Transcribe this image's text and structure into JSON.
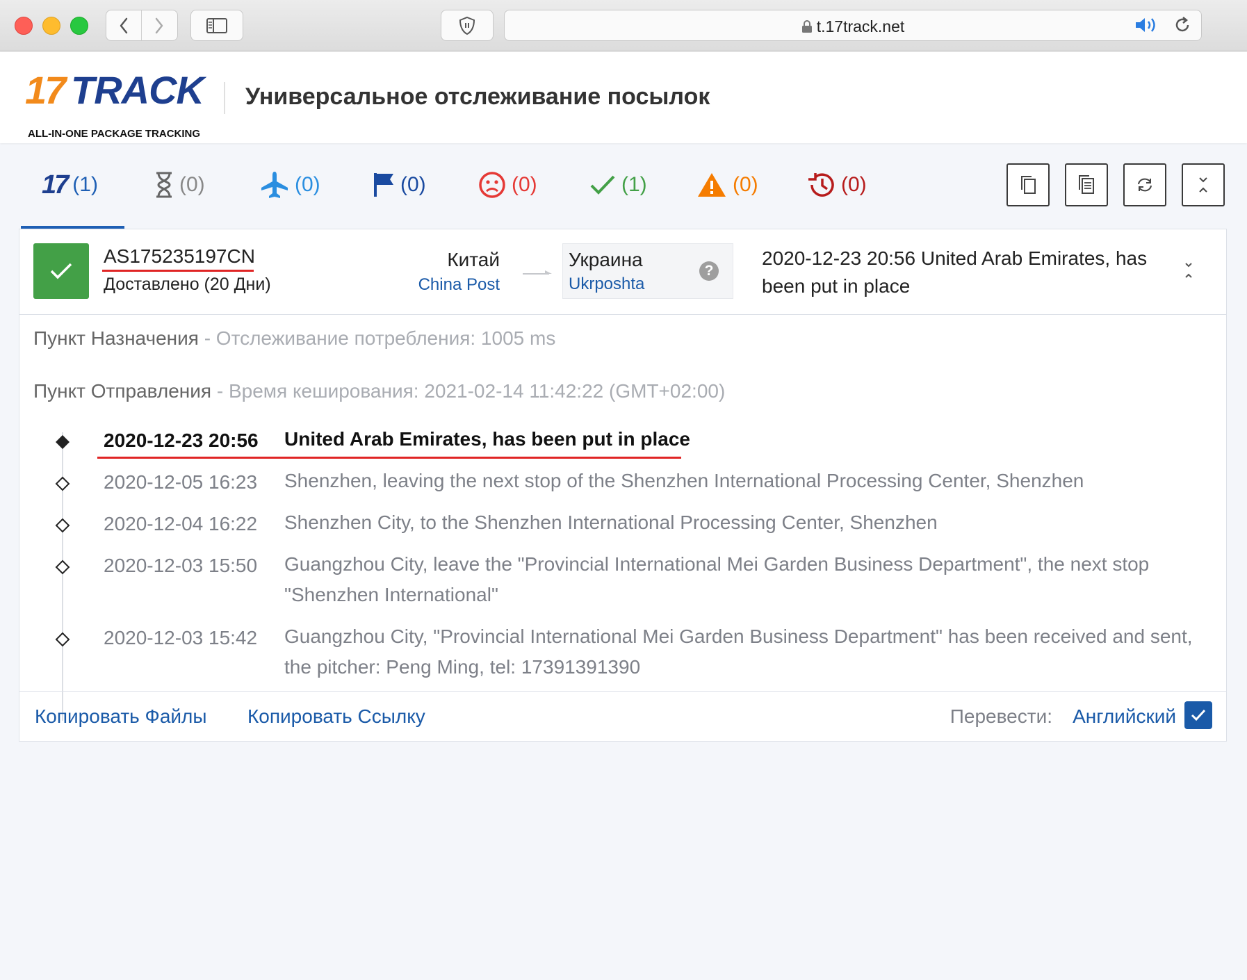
{
  "browser": {
    "url": "t.17track.net"
  },
  "header": {
    "logo_number": "17",
    "logo_word": "TRACK",
    "logo_tagline": "ALL-IN-ONE PACKAGE TRACKING",
    "title": "Универсальное отслеживание посылок"
  },
  "tabs": [
    {
      "icon": "17track-logo-icon",
      "count": "(1)",
      "color": "#1e5fb4"
    },
    {
      "icon": "hourglass-icon",
      "count": "(0)",
      "color": "#888888"
    },
    {
      "icon": "airplane-icon",
      "count": "(0)",
      "color": "#2a8ee0"
    },
    {
      "icon": "flag-icon",
      "count": "(0)",
      "color": "#1a4aa0"
    },
    {
      "icon": "sad-face-icon",
      "count": "(0)",
      "color": "#e53935"
    },
    {
      "icon": "checkmark-icon",
      "count": "(1)",
      "color": "#43a047"
    },
    {
      "icon": "warning-icon",
      "count": "(0)",
      "color": "#f57c00"
    },
    {
      "icon": "history-icon",
      "count": "(0)",
      "color": "#b71c1c"
    }
  ],
  "toolbar": {
    "buttons": [
      "copy-icon",
      "copy-list-icon",
      "refresh-icon",
      "collapse-all-icon"
    ]
  },
  "shipment": {
    "tracking_number": "AS175235197CN",
    "status_text": "Доставлено (20 Дни)",
    "status_color": "#43a047",
    "origin_country": "Китай",
    "origin_carrier": "China Post",
    "destination_country": "Украина",
    "destination_carrier": "Ukrposhta",
    "latest_event": "2020-12-23 20:56  United Arab Emirates, has been put in place"
  },
  "info": {
    "destination_label": "Пункт Назначения",
    "destination_detail": " - Отслеживание потребления: 1005 ms",
    "origin_label": "Пункт Отправления",
    "origin_detail": " - Время кеширования: 2021-02-14 11:42:22 (GMT+02:00)"
  },
  "events": [
    {
      "date": "2020-12-23 20:56",
      "desc": "United Arab Emirates, has been put in place"
    },
    {
      "date": "2020-12-05 16:23",
      "desc": "Shenzhen, leaving the next stop of the Shenzhen International Processing Center, Shenzhen"
    },
    {
      "date": "2020-12-04 16:22",
      "desc": "Shenzhen City, to the Shenzhen International Processing Center, Shenzhen"
    },
    {
      "date": "2020-12-03 15:50",
      "desc": "Guangzhou City, leave the \"Provincial International Mei Garden Business Department\", the next stop \"Shenzhen International\""
    },
    {
      "date": "2020-12-03 15:42",
      "desc": "Guangzhou City, \"Provincial International Mei Garden Business Department\" has been received and sent, the pitcher: Peng Ming, tel: 17391391390"
    }
  ],
  "footer": {
    "copy_files": "Копировать Файлы",
    "copy_link": "Копировать Ссылку",
    "translate_label": "Перевести:",
    "translate_language": "Английский",
    "translate_checked": true
  }
}
